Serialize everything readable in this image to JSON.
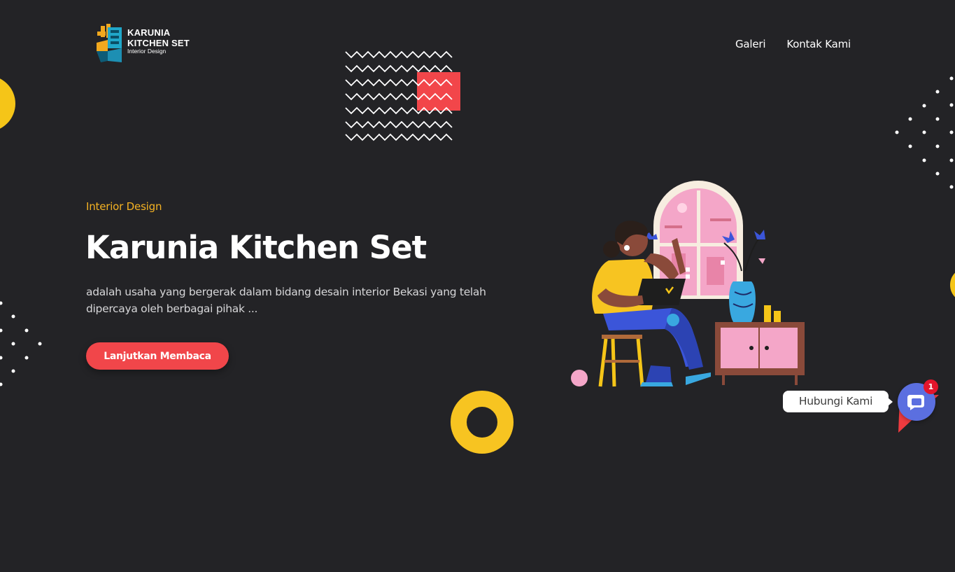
{
  "brand": {
    "line1": "KARUNIA",
    "line2": "KITCHEN SET",
    "tagline": "Interior Design"
  },
  "nav": {
    "items": [
      {
        "label": "Galeri"
      },
      {
        "label": "Kontak Kami"
      }
    ]
  },
  "hero": {
    "eyebrow": "Interior Design",
    "title": "Karunia Kitchen Set",
    "description": "adalah usaha yang bergerak dalam bidang desain interior Bekasi yang telah dipercaya oleh berbagai pihak ...",
    "cta_label": "Lanjutkan Membaca"
  },
  "chat": {
    "label": "Hubungi Kami",
    "badge": "1"
  },
  "colors": {
    "background": "#232326",
    "accent_red": "#f1464a",
    "accent_yellow": "#f5c518",
    "eyebrow_orange": "#f4b223",
    "chat_blue": "#5b6fe0"
  },
  "icons": {
    "logo": "kitchen-set-logo-icon",
    "chat": "chat-bubble-icon"
  }
}
